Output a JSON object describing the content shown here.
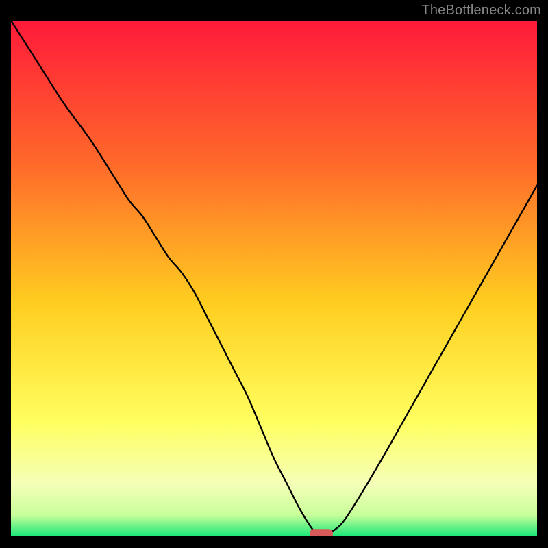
{
  "watermark": "TheBottleneck.com",
  "colors": {
    "gradient_top": "#ff1a3a",
    "gradient_mid1": "#ff6a2a",
    "gradient_mid2": "#ffce20",
    "gradient_mid3": "#ffff60",
    "gradient_mid4": "#f5ffb8",
    "gradient_mid5": "#c8ff9a",
    "gradient_bottom": "#1ee77a",
    "stroke": "#000000",
    "marker": "#d85a5a",
    "frame": "#000000"
  },
  "chart_data": {
    "type": "line",
    "title": "",
    "xlabel": "",
    "ylabel": "",
    "xlim": [
      0,
      100
    ],
    "ylim": [
      0,
      100
    ],
    "x": [
      0,
      5,
      10,
      15,
      20,
      22.5,
      25,
      27.5,
      30,
      32.5,
      35,
      37.5,
      40,
      42.5,
      45,
      47.5,
      50,
      52.5,
      55,
      57.5,
      58.5,
      60,
      61,
      62,
      63,
      65,
      70,
      75,
      80,
      85,
      90,
      95,
      100
    ],
    "y": [
      100,
      92,
      84,
      77,
      69,
      65,
      62,
      58,
      54,
      51,
      47,
      42,
      37,
      32,
      27,
      21,
      15,
      10,
      5,
      1,
      0.4,
      0.4,
      0.8,
      1.5,
      2.5,
      5.5,
      14,
      23,
      32,
      41,
      50,
      59,
      68
    ],
    "annotations": [
      {
        "type": "marker",
        "x_center": 59,
        "y": 0.4,
        "width_x": 4.4,
        "height_y": 1.8
      }
    ]
  }
}
